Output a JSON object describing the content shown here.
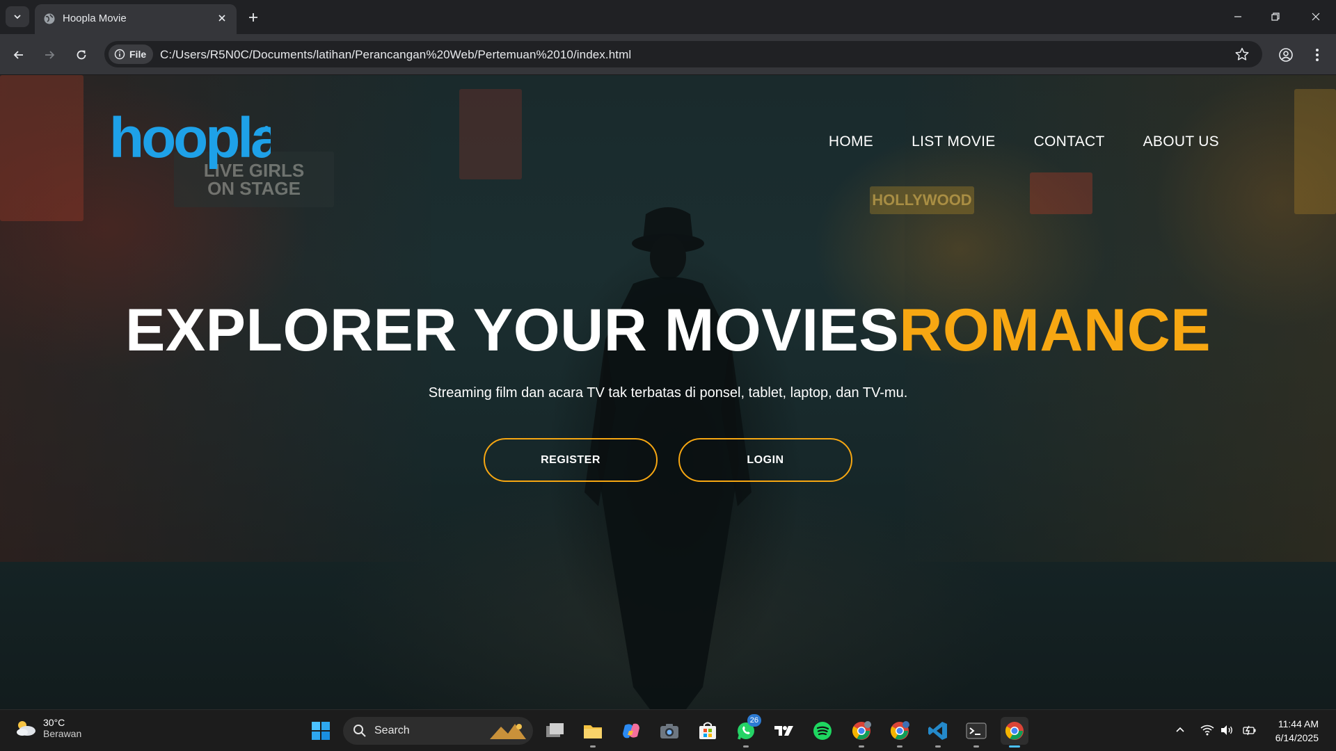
{
  "browser": {
    "tab_title": "Hoopla Movie",
    "site_chip": "File",
    "url": "C:/Users/R5N0C/Documents/latihan/Perancangan%20Web/Pertemuan%2010/index.html"
  },
  "page": {
    "logo_text": "hoopla",
    "nav": [
      "HOME",
      "LIST MOVIE",
      "CONTACT",
      "ABOUT US"
    ],
    "headline_main": "EXPLORER YOUR MOVIES",
    "headline_accent": "ROMANCE",
    "subheadline": "Streaming film dan acara TV tak terbatas di ponsel, tablet, laptop, dan TV-mu.",
    "register_label": "REGISTER",
    "login_label": "LOGIN",
    "background_signs": [
      "LIVE GIRLS",
      "ON STAGE",
      "HOLLYWOOD"
    ]
  },
  "taskbar": {
    "weather_temp": "30°C",
    "weather_condition": "Berawan",
    "search_label": "Search",
    "whatsapp_badge": "26",
    "time": "11:44 AM",
    "date": "6/14/2025"
  },
  "colors": {
    "accent": "#f7a712",
    "logo_blue": "#1ea1e8",
    "chrome_dark": "#202124",
    "chrome_toolbar": "#35363a"
  }
}
